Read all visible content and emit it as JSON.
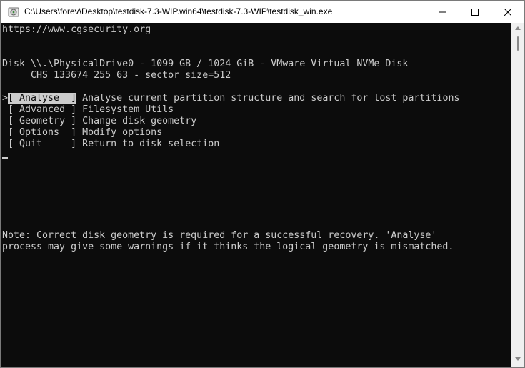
{
  "window": {
    "title": "C:\\Users\\forev\\Desktop\\testdisk-7.3-WIP.win64\\testdisk-7.3-WIP\\testdisk_win.exe"
  },
  "console": {
    "url_line": "https://www.cgsecurity.org",
    "disk_line": "Disk \\\\.\\PhysicalDrive0 - 1099 GB / 1024 GiB - VMware Virtual NVMe Disk",
    "chs_line": "     CHS 133674 255 63 - sector size=512",
    "menu": [
      {
        "marker": ">",
        "label": "[ Analyse  ]",
        "description": " Analyse current partition structure and search for lost partitions"
      },
      {
        "marker": " ",
        "label": "[ Advanced ]",
        "description": " Filesystem Utils"
      },
      {
        "marker": " ",
        "label": "[ Geometry ]",
        "description": " Change disk geometry"
      },
      {
        "marker": " ",
        "label": "[ Options  ]",
        "description": " Modify options"
      },
      {
        "marker": " ",
        "label": "[ Quit     ]",
        "description": " Return to disk selection"
      }
    ],
    "note_line1": "Note: Correct disk geometry is required for a successful recovery. 'Analyse'",
    "note_line2": "process may give some warnings if it thinks the logical geometry is mismatched."
  },
  "colors": {
    "console_bg": "#0c0c0c",
    "console_fg": "#cccccc",
    "titlebar_bg": "#ffffff"
  },
  "icons": {
    "app": "testdisk-app-icon",
    "minimize": "minimize-icon",
    "maximize": "maximize-icon",
    "close": "close-icon"
  }
}
